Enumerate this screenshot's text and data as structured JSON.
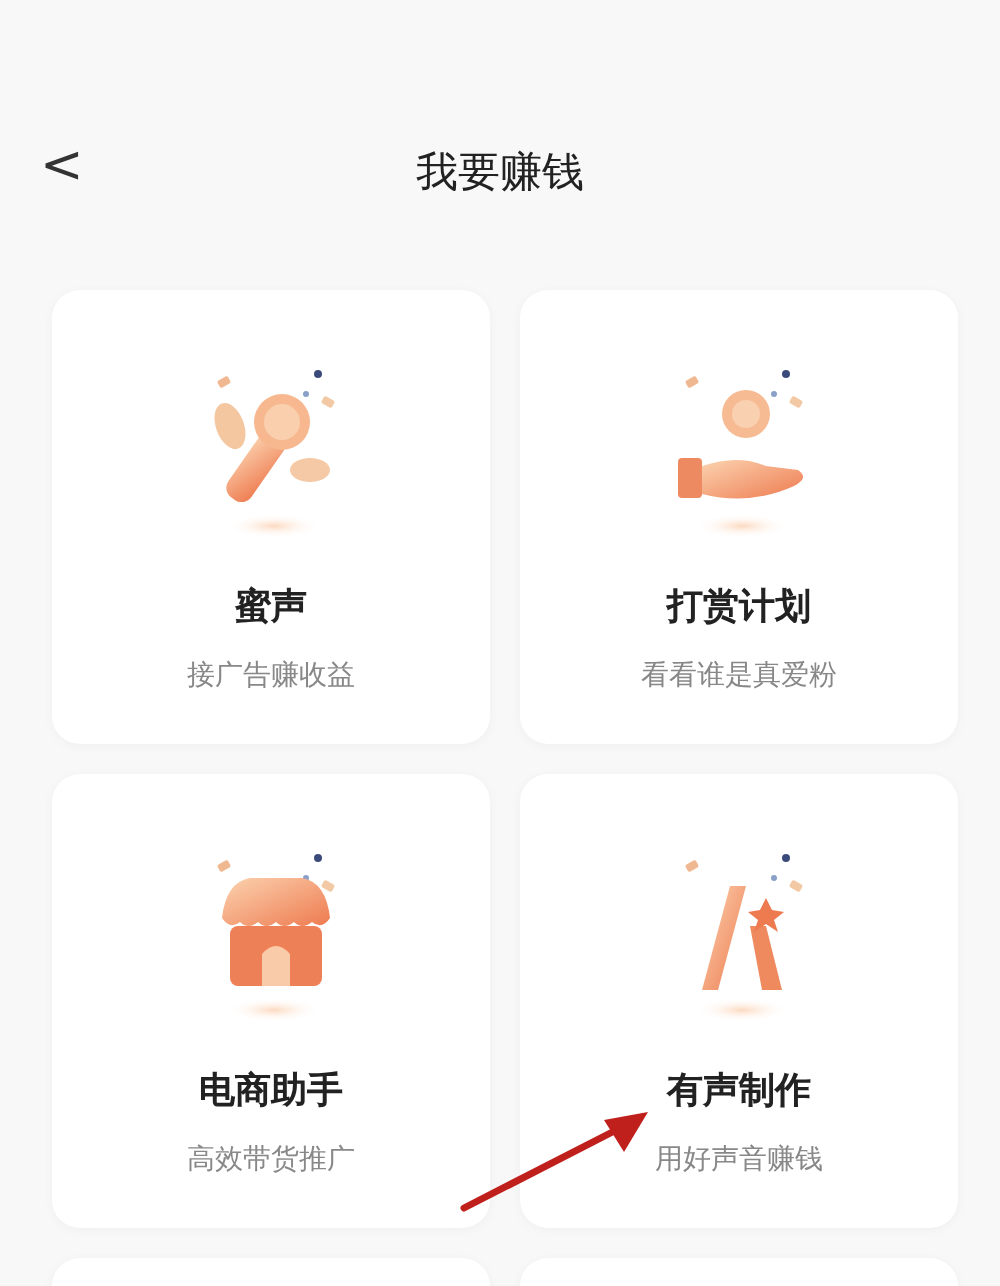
{
  "header": {
    "back": "<",
    "title": "我要赚钱"
  },
  "cards": [
    {
      "kind": "microphone",
      "title": "蜜声",
      "subtitle": "接广告赚收益"
    },
    {
      "kind": "coin-hand",
      "title": "打赏计划",
      "subtitle": "看看谁是真爱粉"
    },
    {
      "kind": "shop",
      "title": "电商助手",
      "subtitle": "高效带货推广"
    },
    {
      "kind": "star-a",
      "title": "有声制作",
      "subtitle": "用好声音赚钱"
    }
  ],
  "more_cards": [
    {
      "kind": "blank"
    },
    {
      "kind": "blank"
    }
  ]
}
